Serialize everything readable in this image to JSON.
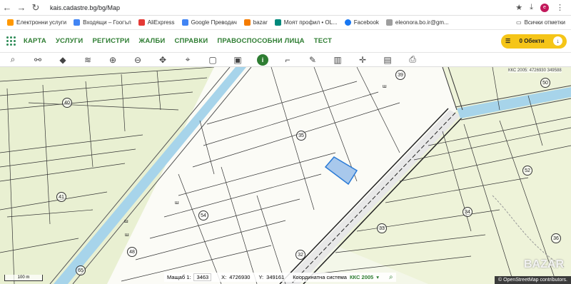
{
  "browser": {
    "url": "kais.cadastre.bg/bg/Map",
    "avatar_letter": "e",
    "bookmarks": [
      {
        "label": "Електронни услуги",
        "color": "#ff9800"
      },
      {
        "label": "Входящи – Гоогъл",
        "color": "#4285f4"
      },
      {
        "label": "AliExpress",
        "color": "#e53935"
      },
      {
        "label": "Google Преводач",
        "color": "#4285f4"
      },
      {
        "label": "bazar",
        "color": "#f57c00"
      },
      {
        "label": "Моят профил • OL...",
        "color": "#00897b"
      },
      {
        "label": "Facebook",
        "color": "#1877f2"
      },
      {
        "label": "eleonora.bo.ir@gm...",
        "color": "#9e9e9e"
      }
    ],
    "all_bookmarks_label": "Всички отметки"
  },
  "menu": {
    "items": [
      "КАРТА",
      "УСЛУГИ",
      "РЕГИСТРИ",
      "ЖАЛБИ",
      "СПРАВКИ",
      "ПРАВОСПОСОБНИ ЛИЦА",
      "ТЕСТ"
    ],
    "objects_label": "0 Обекти"
  },
  "toolbar": {
    "tools": [
      "search-icon",
      "measure-icon",
      "layers-icon",
      "layers-stack-icon",
      "zoom-in-icon",
      "zoom-out-icon",
      "pan-icon",
      "marker-icon",
      "select-rect-icon",
      "select-rect-alt-icon",
      "info-icon",
      "corner-icon",
      "draw-icon",
      "map-icon",
      "crosshair-icon",
      "document-icon",
      "print-icon"
    ]
  },
  "map": {
    "kks_top": "ККС 2005: 4726930 349588",
    "parcels": [
      "40",
      "39",
      "50",
      "35",
      "52",
      "41",
      "54",
      "34",
      "33",
      "48",
      "65",
      "32",
      "36"
    ],
    "sh_marks": [
      "ш",
      "ш",
      "ш",
      "ш"
    ],
    "scale_bar": "100 m",
    "scale_label": "Мащаб 1:",
    "scale_value": "3463",
    "x_label": "X:",
    "x_value": "4726930",
    "y_label": "Y:",
    "y_value": "349161",
    "coord_sys_label": "Координатна система",
    "coord_sys_value": "ККС 2005",
    "osm_credit": "© OpenStreetMap contributors.",
    "watermark": "BAZAR"
  }
}
